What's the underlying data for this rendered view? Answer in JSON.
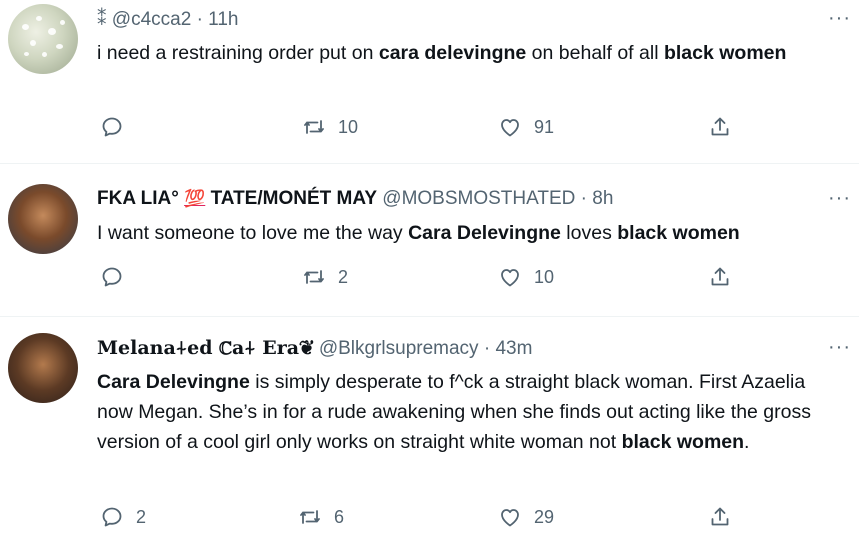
{
  "tweets": [
    {
      "emoji": "⁑",
      "name": "",
      "handle": "@c4cca2",
      "time": "11h",
      "text_parts": [
        {
          "t": "i need a restraining order put on ",
          "b": false
        },
        {
          "t": "cara delevingne",
          "b": true
        },
        {
          "t": " on behalf of all ",
          "b": false
        },
        {
          "t": "black women",
          "b": true
        }
      ],
      "replies": "",
      "retweets": "10",
      "likes": "91"
    },
    {
      "name": "FKA LIA°",
      "emoji": "💯",
      "name_suffix": "TATE/MONÉT MAY",
      "handle": "@MOBSMOSTHATED",
      "time": "8h",
      "text_parts": [
        {
          "t": "I want someone to love me the way ",
          "b": false
        },
        {
          "t": "Cara Delevingne",
          "b": true
        },
        {
          "t": " loves ",
          "b": false
        },
        {
          "t": "black women",
          "b": true
        }
      ],
      "replies": "",
      "retweets": "2",
      "likes": "10"
    },
    {
      "name": "Melana⍭ed ℂa⍭ Era❦",
      "handle": "@Blkgrlsupremacy",
      "time": "43m",
      "text_parts": [
        {
          "t": "Cara Delevingne",
          "b": true
        },
        {
          "t": " is simply desperate to f^ck a straight black woman. First Azaelia now Megan. She’s in for a rude awakening when she finds out acting like the gross version of a cool girl only works on straight white woman not ",
          "b": false
        },
        {
          "t": "black women",
          "b": true
        },
        {
          "t": ".",
          "b": false
        }
      ],
      "replies": "2",
      "retweets": "6",
      "likes": "29"
    }
  ],
  "separator": "·",
  "more_label": "···",
  "icons": [
    "reply-icon",
    "retweet-icon",
    "like-icon",
    "share-icon",
    "more-icon"
  ]
}
